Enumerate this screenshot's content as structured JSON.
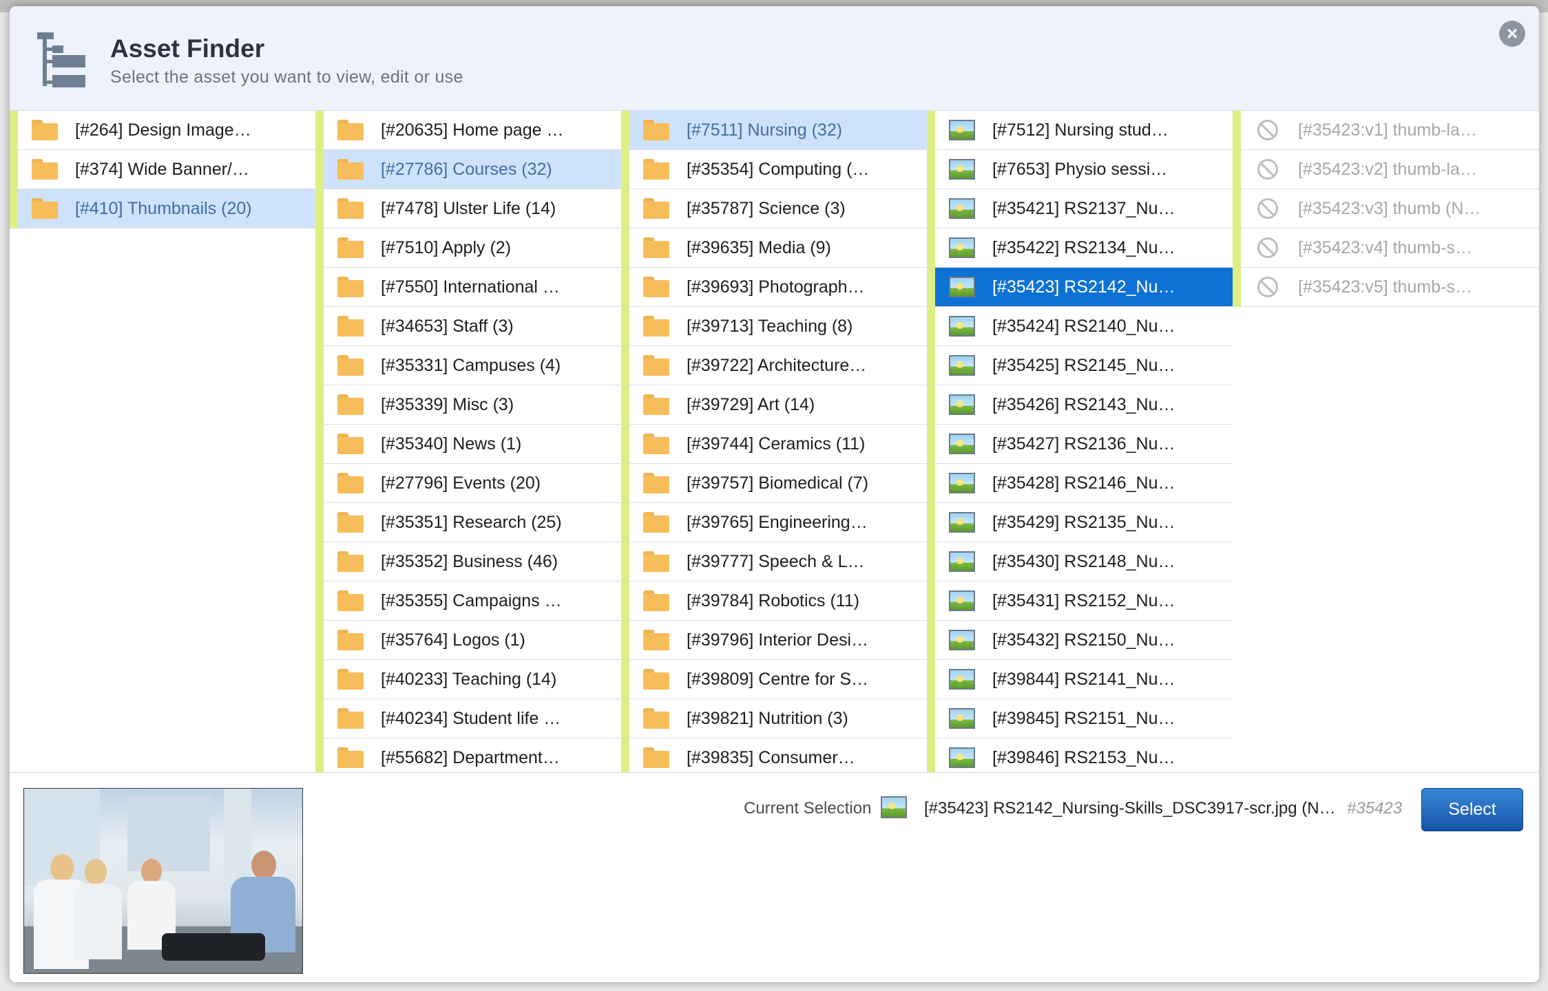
{
  "dialog": {
    "title": "Asset Finder",
    "subtitle": "Select the asset you want to view, edit or use",
    "close_symbol": "×"
  },
  "columns": [
    {
      "items": [
        {
          "label": "[#264] Design Image…",
          "icon": "folder-icon",
          "state": "normal"
        },
        {
          "label": "[#374] Wide Banner/…",
          "icon": "folder-icon",
          "state": "normal"
        },
        {
          "label": "[#410] Thumbnails (20)",
          "icon": "folder-icon",
          "state": "selected"
        }
      ]
    },
    {
      "items": [
        {
          "label": "[#20635] Home page …",
          "icon": "folder-icon",
          "state": "normal"
        },
        {
          "label": "[#27786] Courses (32)",
          "icon": "folder-icon",
          "state": "selected"
        },
        {
          "label": "[#7478] Ulster Life (14)",
          "icon": "folder-icon",
          "state": "normal"
        },
        {
          "label": "[#7510] Apply (2)",
          "icon": "folder-icon",
          "state": "normal"
        },
        {
          "label": "[#7550] International …",
          "icon": "folder-icon",
          "state": "normal"
        },
        {
          "label": "[#34653] Staff (3)",
          "icon": "folder-icon",
          "state": "normal"
        },
        {
          "label": "[#35331] Campuses (4)",
          "icon": "folder-icon",
          "state": "normal"
        },
        {
          "label": "[#35339] Misc (3)",
          "icon": "folder-icon",
          "state": "normal"
        },
        {
          "label": "[#35340] News (1)",
          "icon": "folder-icon",
          "state": "normal"
        },
        {
          "label": "[#27796] Events (20)",
          "icon": "folder-icon",
          "state": "normal"
        },
        {
          "label": "[#35351] Research (25)",
          "icon": "folder-icon",
          "state": "normal"
        },
        {
          "label": "[#35352] Business (46)",
          "icon": "folder-icon",
          "state": "normal"
        },
        {
          "label": "[#35355] Campaigns …",
          "icon": "folder-icon",
          "state": "normal"
        },
        {
          "label": "[#35764] Logos (1)",
          "icon": "folder-icon",
          "state": "normal"
        },
        {
          "label": "[#40233] Teaching (14)",
          "icon": "folder-icon",
          "state": "normal"
        },
        {
          "label": "[#40234] Student life …",
          "icon": "folder-icon",
          "state": "normal"
        },
        {
          "label": "[#55682] Department…",
          "icon": "folder-icon",
          "state": "normal"
        }
      ]
    },
    {
      "items": [
        {
          "label": "[#7511] Nursing (32)",
          "icon": "folder-icon",
          "state": "selected"
        },
        {
          "label": "[#35354] Computing (…",
          "icon": "folder-icon",
          "state": "normal"
        },
        {
          "label": "[#35787] Science (3)",
          "icon": "folder-icon",
          "state": "normal"
        },
        {
          "label": "[#39635] Media (9)",
          "icon": "folder-icon",
          "state": "normal"
        },
        {
          "label": "[#39693] Photograph…",
          "icon": "folder-icon",
          "state": "normal"
        },
        {
          "label": "[#39713] Teaching (8)",
          "icon": "folder-icon",
          "state": "normal"
        },
        {
          "label": "[#39722] Architecture…",
          "icon": "folder-icon",
          "state": "normal"
        },
        {
          "label": "[#39729] Art (14)",
          "icon": "folder-icon",
          "state": "normal"
        },
        {
          "label": "[#39744] Ceramics (11)",
          "icon": "folder-icon",
          "state": "normal"
        },
        {
          "label": "[#39757] Biomedical (7)",
          "icon": "folder-icon",
          "state": "normal"
        },
        {
          "label": "[#39765] Engineering…",
          "icon": "folder-icon",
          "state": "normal"
        },
        {
          "label": "[#39777] Speech & L…",
          "icon": "folder-icon",
          "state": "normal"
        },
        {
          "label": "[#39784] Robotics (11)",
          "icon": "folder-icon",
          "state": "normal"
        },
        {
          "label": "[#39796] Interior Desi…",
          "icon": "folder-icon",
          "state": "normal"
        },
        {
          "label": "[#39809] Centre for S…",
          "icon": "folder-icon",
          "state": "normal"
        },
        {
          "label": "[#39821] Nutrition (3)",
          "icon": "folder-icon",
          "state": "normal"
        },
        {
          "label": "[#39835] Consumer…",
          "icon": "folder-icon",
          "state": "normal"
        }
      ]
    },
    {
      "items": [
        {
          "label": "[#7512] Nursing stud…",
          "icon": "image-icon",
          "state": "normal"
        },
        {
          "label": "[#7653] Physio sessi…",
          "icon": "image-icon",
          "state": "normal"
        },
        {
          "label": "[#35421] RS2137_Nu…",
          "icon": "image-icon",
          "state": "normal"
        },
        {
          "label": "[#35422] RS2134_Nu…",
          "icon": "image-icon",
          "state": "normal"
        },
        {
          "label": "[#35423] RS2142_Nu…",
          "icon": "image-icon",
          "state": "active"
        },
        {
          "label": "[#35424] RS2140_Nu…",
          "icon": "image-icon",
          "state": "normal"
        },
        {
          "label": "[#35425] RS2145_Nu…",
          "icon": "image-icon",
          "state": "normal"
        },
        {
          "label": "[#35426] RS2143_Nu…",
          "icon": "image-icon",
          "state": "normal"
        },
        {
          "label": "[#35427] RS2136_Nu…",
          "icon": "image-icon",
          "state": "normal"
        },
        {
          "label": "[#35428] RS2146_Nu…",
          "icon": "image-icon",
          "state": "normal"
        },
        {
          "label": "[#35429] RS2135_Nu…",
          "icon": "image-icon",
          "state": "normal"
        },
        {
          "label": "[#35430] RS2148_Nu…",
          "icon": "image-icon",
          "state": "normal"
        },
        {
          "label": "[#35431] RS2152_Nu…",
          "icon": "image-icon",
          "state": "normal"
        },
        {
          "label": "[#35432] RS2150_Nu…",
          "icon": "image-icon",
          "state": "normal"
        },
        {
          "label": "[#39844] RS2141_Nu…",
          "icon": "image-icon",
          "state": "normal"
        },
        {
          "label": "[#39845] RS2151_Nu…",
          "icon": "image-icon",
          "state": "normal"
        },
        {
          "label": "[#39846] RS2153_Nu…",
          "icon": "image-icon",
          "state": "normal"
        }
      ]
    },
    {
      "items": [
        {
          "label": "[#35423:v1] thumb-la…",
          "icon": "no-access-icon",
          "state": "disabled"
        },
        {
          "label": "[#35423:v2] thumb-la…",
          "icon": "no-access-icon",
          "state": "disabled"
        },
        {
          "label": "[#35423:v3] thumb (N…",
          "icon": "no-access-icon",
          "state": "disabled"
        },
        {
          "label": "[#35423:v4] thumb-s…",
          "icon": "no-access-icon",
          "state": "disabled"
        },
        {
          "label": "[#35423:v5] thumb-s…",
          "icon": "no-access-icon",
          "state": "disabled"
        }
      ]
    }
  ],
  "footer": {
    "current_selection_label": "Current Selection",
    "current_selection_name": "[#35423] RS2142_Nursing-Skills_DSC3917-scr.jpg (N…",
    "current_selection_id": "#35423",
    "select_button": "Select"
  },
  "colors": {
    "selected_row": "#cfe2fb",
    "active_row": "#0e72d4",
    "row_accent": "#dcef82",
    "folder": "#f7bd5b",
    "button": "#1f67bd"
  }
}
